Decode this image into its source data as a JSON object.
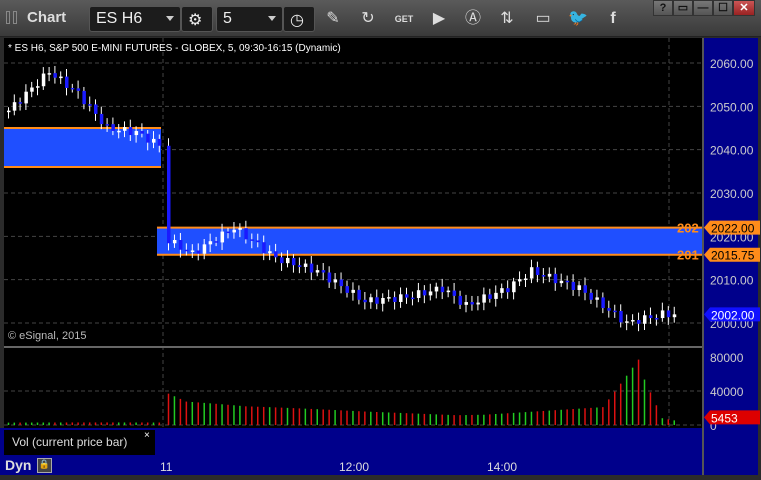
{
  "window": {
    "title": "Chart",
    "symbol": "ES H6",
    "interval": "5",
    "buttons": [
      "?",
      "▭",
      "—",
      "☐",
      "✕"
    ]
  },
  "toolbar_icons": [
    "gear-icon",
    "clock-icon",
    "pencil-icon",
    "refresh-icon",
    "get-icon",
    "play-icon",
    "alert-icon",
    "link-icon",
    "comment-icon",
    "twitter-icon",
    "facebook-icon"
  ],
  "chart": {
    "header": "* ES H6, S&P 500 E-MINI FUTURES - GLOBEX, 5, 09:30-16:15 (Dynamic)",
    "copyright": "© eSignal, 2015",
    "volume_label": "Vol (current price bar)",
    "close_x": "×",
    "mode": "Dyn"
  },
  "markers": {
    "upper_label": "202",
    "upper_value": "2022.00",
    "lower_label": "201",
    "lower_value": "2015.75",
    "last_price": "2002.00",
    "last_volume": "5453"
  },
  "colors": {
    "axis_bg": "#00008b",
    "zone": "#1f4fff",
    "zone_border": "#ff8c1a",
    "up": "#ffffff",
    "down": "#1a1aff",
    "vol_up": "#22cc22",
    "vol_down": "#dd1111"
  },
  "chart_data": {
    "type": "candlestick",
    "y_ticks": [
      "2060.00",
      "2050.00",
      "2040.00",
      "2030.00",
      "2020.00",
      "2010.00",
      "2000.00"
    ],
    "y_range": [
      1995,
      2064
    ],
    "vol_ticks": [
      "80000",
      "40000",
      "0"
    ],
    "vol_range": [
      0,
      85000
    ],
    "x_ticks": [
      "11",
      "12:00",
      "14:00"
    ],
    "zones": [
      {
        "from": 2036,
        "to": 2045,
        "session": "prior"
      },
      {
        "from": 2015.75,
        "to": 2022,
        "session": "current"
      }
    ],
    "price_path": [
      [
        0,
        2049
      ],
      [
        7,
        2058
      ],
      [
        12,
        2053
      ],
      [
        17,
        2045
      ],
      [
        22,
        2044
      ],
      [
        26,
        2041
      ],
      [
        27,
        2019
      ],
      [
        31,
        2016
      ],
      [
        38,
        2022
      ],
      [
        45,
        2015
      ],
      [
        52,
        2012
      ],
      [
        60,
        2005
      ],
      [
        67,
        2006
      ],
      [
        73,
        2008
      ],
      [
        77,
        2004
      ],
      [
        84,
        2008
      ],
      [
        88,
        2012
      ],
      [
        96,
        2008
      ],
      [
        101,
        2003
      ],
      [
        104,
        2000
      ],
      [
        110,
        2002
      ],
      [
        112,
        2002
      ]
    ],
    "volume_path": [
      [
        0,
        4000
      ],
      [
        26,
        3000
      ],
      [
        27,
        38000
      ],
      [
        30,
        28000
      ],
      [
        40,
        22000
      ],
      [
        60,
        18000
      ],
      [
        80,
        16000
      ],
      [
        100,
        22000
      ],
      [
        106,
        78000
      ],
      [
        107,
        54000
      ],
      [
        110,
        8000
      ],
      [
        112,
        5453
      ]
    ]
  }
}
